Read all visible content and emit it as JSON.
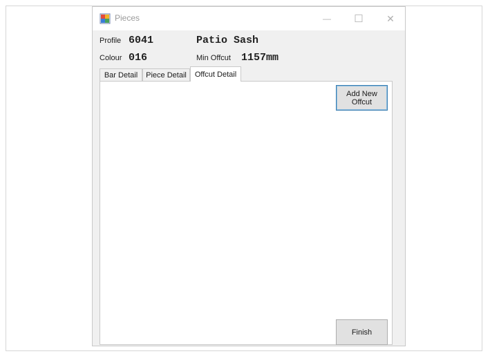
{
  "window": {
    "title": "Pieces",
    "controls": {
      "minimize": "—",
      "maximize": "☐",
      "close": "✕"
    }
  },
  "header": {
    "profile_label": "Profile",
    "profile_value": "6041",
    "profile_name": "Patio Sash",
    "colour_label": "Colour",
    "colour_value": "016",
    "min_offcut_label": "Min Offcut",
    "min_offcut_value": "1157mm"
  },
  "tabs": [
    {
      "label": "Bar Detail",
      "active": false
    },
    {
      "label": "Piece Detail",
      "active": false
    },
    {
      "label": "Offcut Detail",
      "active": true
    }
  ],
  "panel": {
    "add_button_label_line1": "Add New",
    "add_button_label_line2": "Offcut",
    "finish_button_label": "Finish"
  },
  "icons": {
    "app_icon": "pieces-app-icon"
  },
  "colors": {
    "window_bg": "#f0f0f0",
    "panel_bg": "#ffffff",
    "button_bg": "#e1e1e1",
    "focus_border": "#3c7fb1"
  }
}
